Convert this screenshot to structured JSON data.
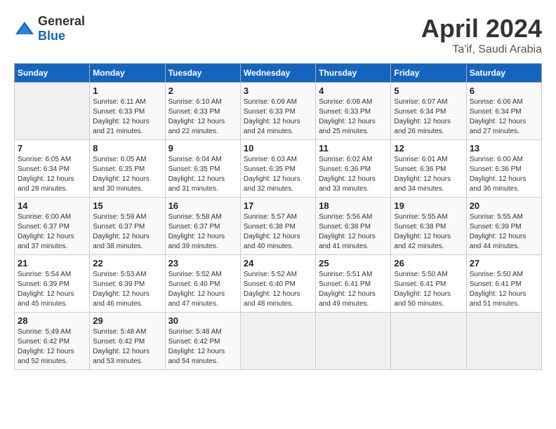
{
  "header": {
    "logo_general": "General",
    "logo_blue": "Blue",
    "month_title": "April 2024",
    "location": "Ta'if, Saudi Arabia"
  },
  "weekdays": [
    "Sunday",
    "Monday",
    "Tuesday",
    "Wednesday",
    "Thursday",
    "Friday",
    "Saturday"
  ],
  "weeks": [
    [
      {
        "day": "",
        "info": ""
      },
      {
        "day": "1",
        "info": "Sunrise: 6:11 AM\nSunset: 6:33 PM\nDaylight: 12 hours\nand 21 minutes."
      },
      {
        "day": "2",
        "info": "Sunrise: 6:10 AM\nSunset: 6:33 PM\nDaylight: 12 hours\nand 22 minutes."
      },
      {
        "day": "3",
        "info": "Sunrise: 6:09 AM\nSunset: 6:33 PM\nDaylight: 12 hours\nand 24 minutes."
      },
      {
        "day": "4",
        "info": "Sunrise: 6:08 AM\nSunset: 6:33 PM\nDaylight: 12 hours\nand 25 minutes."
      },
      {
        "day": "5",
        "info": "Sunrise: 6:07 AM\nSunset: 6:34 PM\nDaylight: 12 hours\nand 26 minutes."
      },
      {
        "day": "6",
        "info": "Sunrise: 6:06 AM\nSunset: 6:34 PM\nDaylight: 12 hours\nand 27 minutes."
      }
    ],
    [
      {
        "day": "7",
        "info": "Sunrise: 6:05 AM\nSunset: 6:34 PM\nDaylight: 12 hours\nand 28 minutes."
      },
      {
        "day": "8",
        "info": "Sunrise: 6:05 AM\nSunset: 6:35 PM\nDaylight: 12 hours\nand 30 minutes."
      },
      {
        "day": "9",
        "info": "Sunrise: 6:04 AM\nSunset: 6:35 PM\nDaylight: 12 hours\nand 31 minutes."
      },
      {
        "day": "10",
        "info": "Sunrise: 6:03 AM\nSunset: 6:35 PM\nDaylight: 12 hours\nand 32 minutes."
      },
      {
        "day": "11",
        "info": "Sunrise: 6:02 AM\nSunset: 6:36 PM\nDaylight: 12 hours\nand 33 minutes."
      },
      {
        "day": "12",
        "info": "Sunrise: 6:01 AM\nSunset: 6:36 PM\nDaylight: 12 hours\nand 34 minutes."
      },
      {
        "day": "13",
        "info": "Sunrise: 6:00 AM\nSunset: 6:36 PM\nDaylight: 12 hours\nand 36 minutes."
      }
    ],
    [
      {
        "day": "14",
        "info": "Sunrise: 6:00 AM\nSunset: 6:37 PM\nDaylight: 12 hours\nand 37 minutes."
      },
      {
        "day": "15",
        "info": "Sunrise: 5:59 AM\nSunset: 6:37 PM\nDaylight: 12 hours\nand 38 minutes."
      },
      {
        "day": "16",
        "info": "Sunrise: 5:58 AM\nSunset: 6:37 PM\nDaylight: 12 hours\nand 39 minutes."
      },
      {
        "day": "17",
        "info": "Sunrise: 5:57 AM\nSunset: 6:38 PM\nDaylight: 12 hours\nand 40 minutes."
      },
      {
        "day": "18",
        "info": "Sunrise: 5:56 AM\nSunset: 6:38 PM\nDaylight: 12 hours\nand 41 minutes."
      },
      {
        "day": "19",
        "info": "Sunrise: 5:55 AM\nSunset: 6:38 PM\nDaylight: 12 hours\nand 42 minutes."
      },
      {
        "day": "20",
        "info": "Sunrise: 5:55 AM\nSunset: 6:39 PM\nDaylight: 12 hours\nand 44 minutes."
      }
    ],
    [
      {
        "day": "21",
        "info": "Sunrise: 5:54 AM\nSunset: 6:39 PM\nDaylight: 12 hours\nand 45 minutes."
      },
      {
        "day": "22",
        "info": "Sunrise: 5:53 AM\nSunset: 6:39 PM\nDaylight: 12 hours\nand 46 minutes."
      },
      {
        "day": "23",
        "info": "Sunrise: 5:52 AM\nSunset: 6:40 PM\nDaylight: 12 hours\nand 47 minutes."
      },
      {
        "day": "24",
        "info": "Sunrise: 5:52 AM\nSunset: 6:40 PM\nDaylight: 12 hours\nand 48 minutes."
      },
      {
        "day": "25",
        "info": "Sunrise: 5:51 AM\nSunset: 6:41 PM\nDaylight: 12 hours\nand 49 minutes."
      },
      {
        "day": "26",
        "info": "Sunrise: 5:50 AM\nSunset: 6:41 PM\nDaylight: 12 hours\nand 50 minutes."
      },
      {
        "day": "27",
        "info": "Sunrise: 5:50 AM\nSunset: 6:41 PM\nDaylight: 12 hours\nand 51 minutes."
      }
    ],
    [
      {
        "day": "28",
        "info": "Sunrise: 5:49 AM\nSunset: 6:42 PM\nDaylight: 12 hours\nand 52 minutes."
      },
      {
        "day": "29",
        "info": "Sunrise: 5:48 AM\nSunset: 6:42 PM\nDaylight: 12 hours\nand 53 minutes."
      },
      {
        "day": "30",
        "info": "Sunrise: 5:48 AM\nSunset: 6:42 PM\nDaylight: 12 hours\nand 54 minutes."
      },
      {
        "day": "",
        "info": ""
      },
      {
        "day": "",
        "info": ""
      },
      {
        "day": "",
        "info": ""
      },
      {
        "day": "",
        "info": ""
      }
    ]
  ]
}
